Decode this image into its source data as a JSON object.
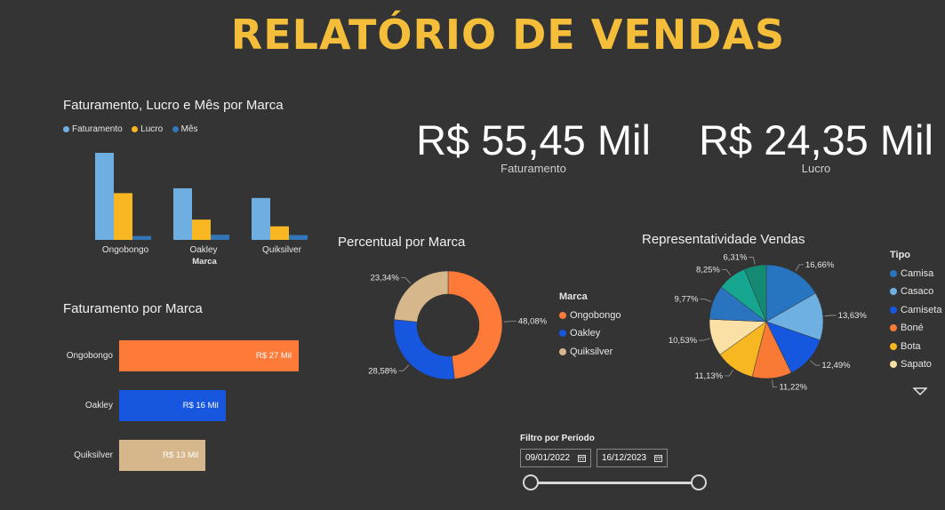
{
  "header": {
    "title": "RELATÓRIO DE VENDAS"
  },
  "colors": {
    "faturamento": "#6EAEE0",
    "lucro": "#F8B621",
    "mes": "#3376B8",
    "ongobongo": "#FD7A38",
    "oakley": "#1757E0",
    "quiksilver": "#D6B78C",
    "camisa": "#2774C1",
    "casaco": "#6FB0E3",
    "camiseta": "#1557DE",
    "bone": "#F97A35",
    "bota": "#F7B720",
    "sapato": "#FBE0A6",
    "t7": "#2A73BE",
    "t8": "#16A690",
    "t9": "#148A72"
  },
  "col_chart": {
    "title": "Faturamento, Lucro e Mês por Marca",
    "legend": [
      "Faturamento",
      "Lucro",
      "Mês"
    ],
    "xlabel": "Marca"
  },
  "kpis": {
    "faturamento_value": "R$ 55,45 Mil",
    "faturamento_label": "Faturamento",
    "lucro_value": "R$ 24,35 Mil",
    "lucro_label": "Lucro"
  },
  "bar_chart": {
    "title": "Faturamento por Marca"
  },
  "donut": {
    "title": "Percentual por Marca",
    "legend_title": "Marca"
  },
  "pie": {
    "title": "Representatividade Vendas",
    "legend_title": "Tipo"
  },
  "filter": {
    "title": "Filtro por Período",
    "start": "09/01/2022",
    "end": "16/12/2023",
    "range_fraction": [
      0,
      1
    ]
  },
  "chart_data": [
    {
      "type": "bar",
      "title": "Faturamento, Lucro e Mês por Marca",
      "xlabel": "Marca",
      "categories": [
        "Ongobongo",
        "Oakley",
        "Quiksilver"
      ],
      "series": [
        {
          "name": "Faturamento",
          "values": [
            27,
            16,
            13
          ]
        },
        {
          "name": "Lucro",
          "values": [
            14.5,
            6.3,
            4.2
          ]
        },
        {
          "name": "Mês",
          "values": [
            1.2,
            1.6,
            1.5
          ]
        }
      ]
    },
    {
      "type": "bar",
      "title": "Faturamento por Marca",
      "categories": [
        "Ongobongo",
        "Oakley",
        "Quiksilver"
      ],
      "values": [
        27,
        16,
        13
      ],
      "labels": [
        "R$ 27 Mil",
        "R$ 16 Mil",
        "R$ 13 Mil"
      ]
    },
    {
      "type": "pie",
      "title": "Percentual por Marca",
      "legend_title": "Marca",
      "categories": [
        "Ongobongo",
        "Oakley",
        "Quiksilver"
      ],
      "values": [
        48.08,
        28.58,
        23.34
      ],
      "labels": [
        "48,08%",
        "28,58%",
        "23,34%"
      ]
    },
    {
      "type": "pie",
      "title": "Representatividade Vendas",
      "legend_title": "Tipo",
      "legend": [
        "Camisa",
        "Casaco",
        "Camiseta",
        "Boné",
        "Bota",
        "Sapato"
      ],
      "values": [
        16.66,
        13.63,
        12.49,
        11.22,
        11.13,
        10.53,
        9.77,
        8.25,
        6.31
      ],
      "labels": [
        "16,66%",
        "13,63%",
        "12,49%",
        "11,22%",
        "11,13%",
        "10,53%",
        "9,77%",
        "8,25%",
        "6,31%"
      ]
    }
  ]
}
